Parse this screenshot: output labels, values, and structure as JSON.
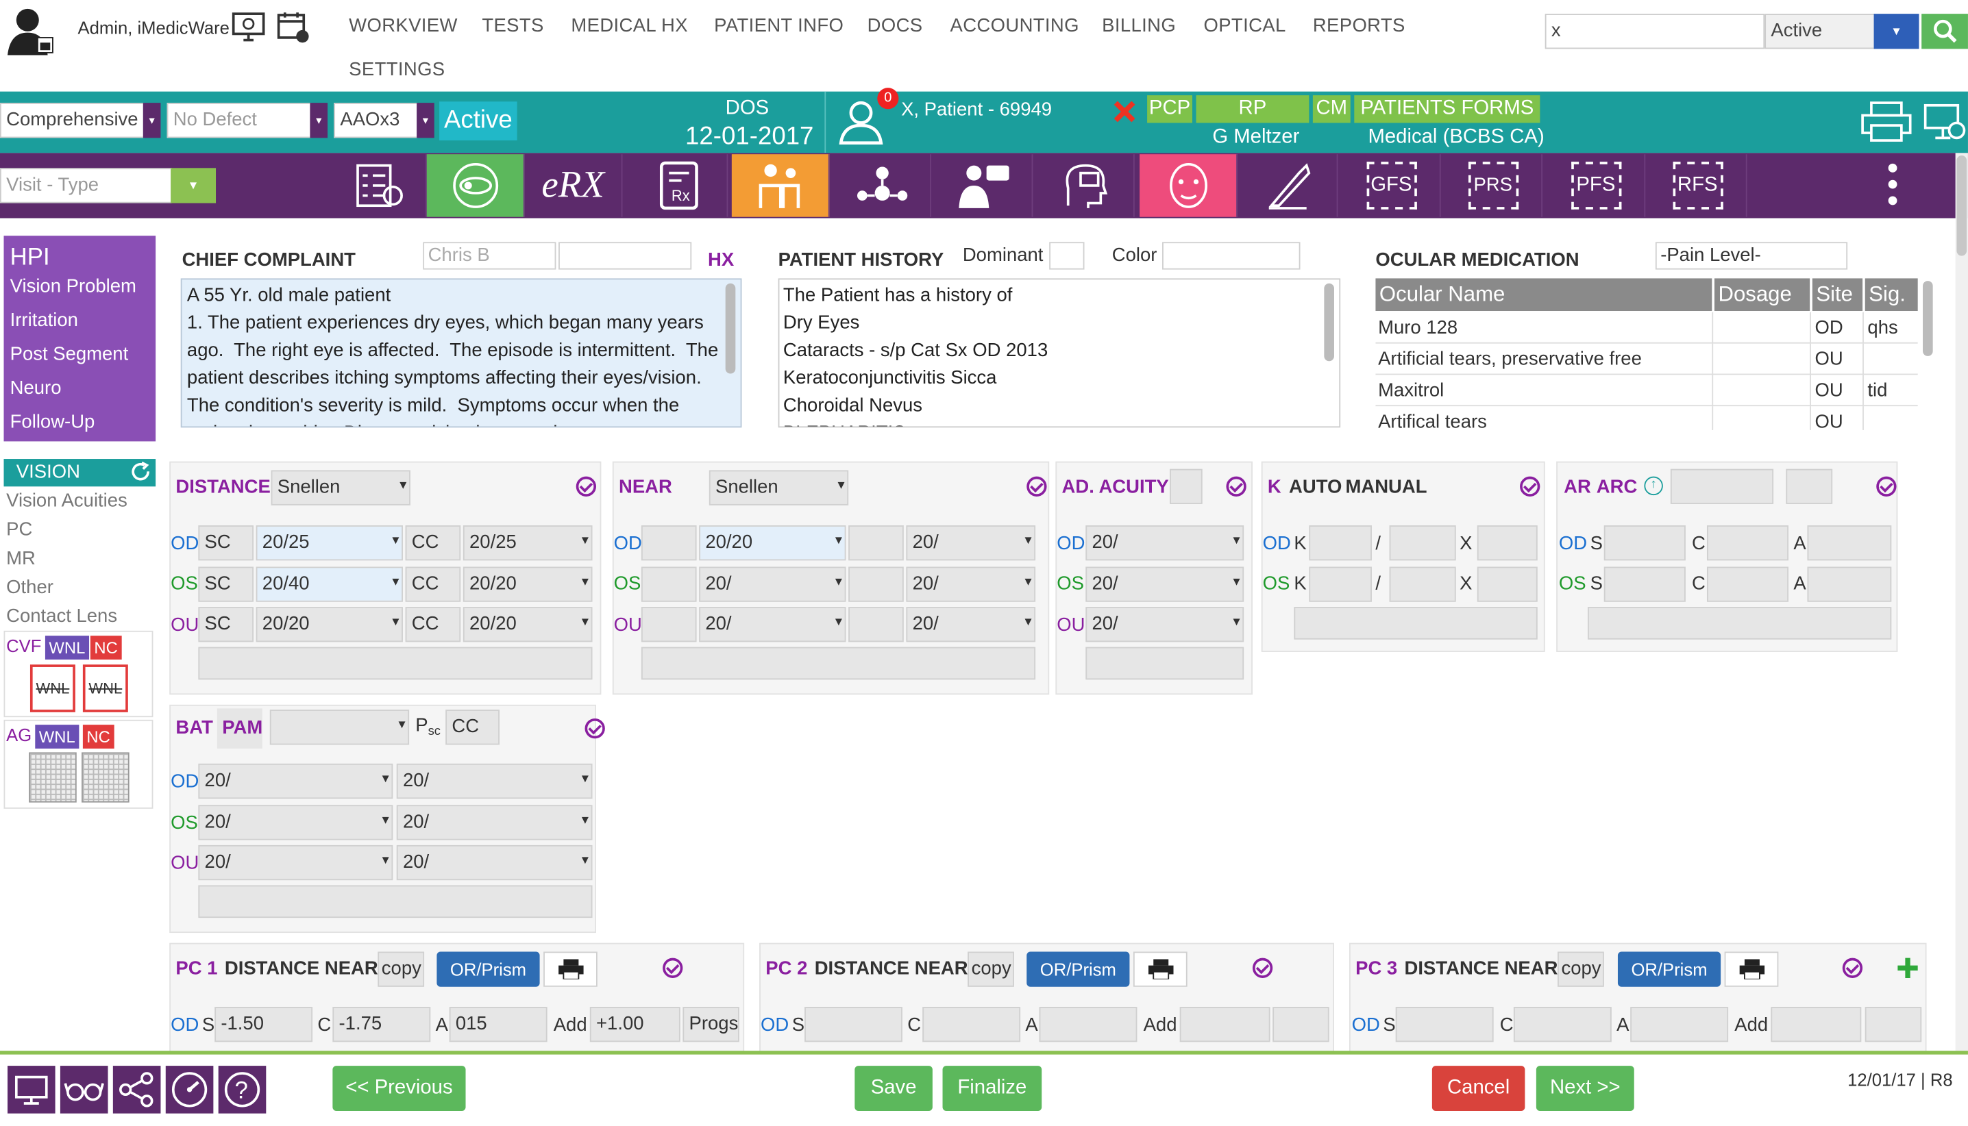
{
  "header": {
    "user": "Admin, iMedicWare",
    "nav": [
      "WORKVIEW",
      "TESTS",
      "MEDICAL HX",
      "PATIENT INFO",
      "DOCS",
      "ACCOUNTING",
      "BILLING",
      "OPTICAL",
      "REPORTS",
      "SETTINGS"
    ],
    "search_value": "x",
    "status_value": "Active"
  },
  "patientbar": {
    "exam_type": "Comprehensive",
    "defect": "No Defect",
    "orientation": "AAOx3",
    "active": "Active",
    "dos_label": "DOS",
    "dos_value": "12-01-2017",
    "alert_count": "0",
    "patient": "X, Patient - 69949",
    "pcp": "PCP",
    "rp": "RP",
    "cm": "CM",
    "forms": "PATIENTS FORMS",
    "provider": "G Meltzer",
    "insurance": "Medical (BCBS CA)"
  },
  "toolbar": {
    "visit_type": "Visit - Type",
    "gfs": "GFS",
    "prs": "PRS",
    "pfs": "PFS",
    "rfs": "RFS",
    "erx": "eRX"
  },
  "sidebar": {
    "hpi": "HPI",
    "hpi_items": [
      "Vision Problem",
      "Irritation",
      "Post Segment",
      "Neuro",
      "Follow-Up"
    ],
    "vision": "VISION",
    "vision_items": [
      "Vision Acuities",
      "PC",
      "MR",
      "Other",
      "Contact Lens"
    ],
    "cvf": "CVF",
    "ag": "AG",
    "wnl": "WNL",
    "nc": "NC"
  },
  "chief": {
    "title": "CHIEF COMPLAINT",
    "provider_placeholder": "Chris B",
    "hx": "HX",
    "text": "A 55 Yr. old male patient\n1. The patient experiences dry eyes, which began many years ago.  The right eye is affected.  The episode is intermittent.  The patient describes itching symptoms affecting their eyes/vision.  The condition's severity is mild.  Symptoms occur when the patient is outside.  Distance vision is currently"
  },
  "history": {
    "title": "PATIENT HISTORY",
    "dominant": "Dominant",
    "color": "Color",
    "text": "The Patient has a history of\nDry Eyes\nCataracts - s/p Cat Sx OD 2013\nKeratoconjunctivitis Sicca\nChoroidal Nevus\nBLEPHARITIS"
  },
  "ocular": {
    "title": "OCULAR MEDICATION",
    "pain": "-Pain Level-",
    "cols": [
      "Ocular Name",
      "Dosage",
      "Site",
      "Sig."
    ],
    "rows": [
      [
        "Muro 128",
        "",
        "OD",
        "qhs"
      ],
      [
        "Artificial tears, preservative free",
        "",
        "OU",
        ""
      ],
      [
        "Maxitrol",
        "",
        "OU",
        "tid"
      ],
      [
        "Artifical tears",
        "",
        "OU",
        ""
      ]
    ]
  },
  "eyes": {
    "od": "OD",
    "os": "OS",
    "ou": "OU"
  },
  "distance": {
    "title": "DISTANCE",
    "chart": "Snellen",
    "sc": "SC",
    "cc": "CC",
    "od_sc": "20/25",
    "od_cc": "20/25",
    "os_sc": "20/40",
    "os_cc": "20/20",
    "ou_sc": "20/20",
    "ou_cc": "20/20"
  },
  "near": {
    "title": "NEAR",
    "chart": "Snellen",
    "od1": "20/20",
    "od2": "20/",
    "os1": "20/",
    "os2": "20/",
    "ou1": "20/",
    "ou2": "20/"
  },
  "ad": {
    "title": "AD. ACUITY",
    "od": "20/",
    "os": "20/",
    "ou": "20/"
  },
  "k": {
    "title": "K",
    "auto": "AUTO",
    "manual": "MANUAL",
    "k": "K",
    "slash": "/",
    "x": "X"
  },
  "ar": {
    "title": "AR",
    "arc": "ARC",
    "s": "S",
    "c": "C",
    "a": "A"
  },
  "bat": {
    "title": "BAT",
    "pam": "PAM",
    "p": "P",
    "sc": "sc",
    "cc": "CC",
    "od1": "20/",
    "od2": "20/",
    "os1": "20/",
    "os2": "20/",
    "ou1": "20/",
    "ou2": "20/"
  },
  "pc": {
    "pc1": "PC 1",
    "pc2": "PC 2",
    "pc3": "PC 3",
    "dn": "DISTANCE NEAR",
    "copy": "copy",
    "orprism": "OR/Prism",
    "s": "S",
    "c": "C",
    "a": "A",
    "add": "Add",
    "progs": "Progs",
    "pc1_s": "-1.50",
    "pc1_c": "-1.75",
    "pc1_a": "015",
    "pc1_add": "+1.00"
  },
  "footer": {
    "previous": "<< Previous",
    "save": "Save",
    "finalize": "Finalize",
    "cancel": "Cancel",
    "next": "Next >>",
    "stamp": "12/01/17 | R8"
  }
}
